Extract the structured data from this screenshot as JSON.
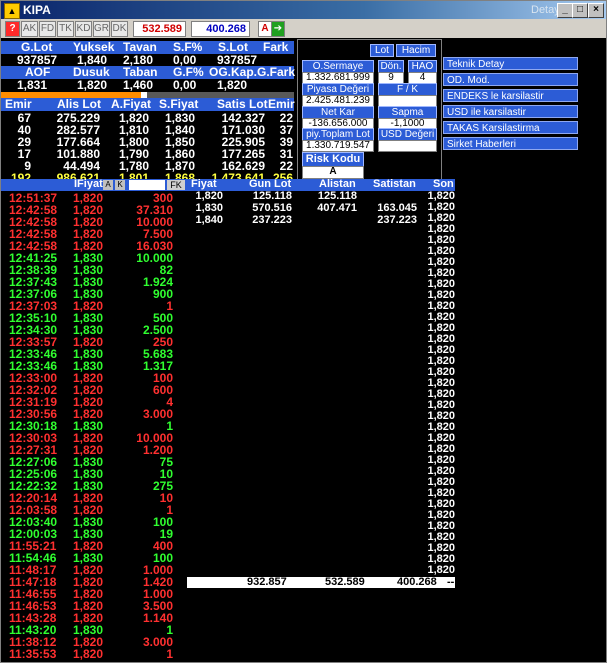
{
  "window": {
    "title": "KIPA",
    "detay": "Detay",
    "minimize": "_",
    "restore": "□",
    "close": "×"
  },
  "toolbar": {
    "tabs": [
      "AK",
      "FD",
      "TK",
      "KD",
      "GR",
      "DK"
    ],
    "val1": "532.589",
    "val2": "400.268",
    "a_label": "A"
  },
  "summary": {
    "headers": [
      "G.Lot",
      "Yuksek",
      "Tavan",
      "S.F%",
      "S.Lot",
      "Fark"
    ],
    "values": [
      "937857",
      "1,840",
      "2,180",
      "0,00",
      "937857",
      ""
    ],
    "headers2": [
      "AOF",
      "Dusuk",
      "Taban",
      "G.F%",
      "OG.Kap.",
      "G.Fark"
    ],
    "values2": [
      "1,831",
      "1,820",
      "1,460",
      "0,00",
      "1,820",
      ""
    ]
  },
  "depth": {
    "headers": [
      "Emir",
      "Alis Lot",
      "A.Fiyat",
      "S.Fiyat",
      "Satis Lot",
      "Emir"
    ],
    "rows": [
      [
        "67",
        "275.229",
        "1,820",
        "1,830",
        "142.327",
        "22"
      ],
      [
        "40",
        "282.577",
        "1,810",
        "1,840",
        "171.030",
        "37"
      ],
      [
        "29",
        "177.664",
        "1,800",
        "1,850",
        "225.905",
        "39"
      ],
      [
        "17",
        "101.880",
        "1,790",
        "1,860",
        "177.265",
        "31"
      ],
      [
        "9",
        "44.494",
        "1,780",
        "1,870",
        "162.629",
        "22"
      ]
    ],
    "total": [
      "192",
      "986.621",
      "1,801",
      "1,868",
      "1.473.641",
      "256"
    ]
  },
  "panel": {
    "lot": "Lot",
    "hacim": "Hacim",
    "osermaye": "O.Sermaye",
    "osermaye_val": "1.332.681.999",
    "don": "Dön.",
    "don_val": "9",
    "hao": "HAO",
    "hao_val": "4",
    "piyasa": "Piyasa Değeri",
    "piyasa_val": "2.425.481.239",
    "fk": "F / K",
    "fk_val": "",
    "netkar": "Net Kar",
    "netkar_val": "-136.656.000",
    "sapma": "Sapma",
    "sapma_val": "-1,1000",
    "piytoplam": "piy.Toplam Lot",
    "piytoplam_val": "1.330.719.547",
    "usd": "USD Değeri",
    "usd_val": "",
    "risk": "Risk Kodu",
    "risk_val": "A"
  },
  "rightmenu": [
    "Teknik Detay",
    "OD. Mod.",
    "ENDEKS le karsilastir",
    "USD ile karsilastir",
    "TAKAS Karsilastirma",
    "Sirket Haberleri"
  ],
  "trades": {
    "headers": [
      "",
      "IFiyat",
      "A",
      "K",
      "FK"
    ],
    "rows": [
      [
        "12:51:37",
        "1,820",
        "300",
        "r"
      ],
      [
        "12:42:58",
        "1,820",
        "37.310",
        "r"
      ],
      [
        "12:42:58",
        "1,820",
        "10.000",
        "r"
      ],
      [
        "12:42:58",
        "1,820",
        "7.500",
        "r"
      ],
      [
        "12:42:58",
        "1,820",
        "16.030",
        "r"
      ],
      [
        "12:41:25",
        "1,830",
        "10.000",
        "g"
      ],
      [
        "12:38:39",
        "1,830",
        "82",
        "g"
      ],
      [
        "12:37:43",
        "1,830",
        "1.924",
        "g"
      ],
      [
        "12:37:06",
        "1,830",
        "900",
        "g"
      ],
      [
        "12:37:03",
        "1,820",
        "1",
        "r"
      ],
      [
        "12:35:10",
        "1,830",
        "500",
        "g"
      ],
      [
        "12:34:30",
        "1,830",
        "2.500",
        "g"
      ],
      [
        "12:33:57",
        "1,820",
        "250",
        "r"
      ],
      [
        "12:33:46",
        "1,830",
        "5.683",
        "g"
      ],
      [
        "12:33:46",
        "1,830",
        "1.317",
        "g"
      ],
      [
        "12:33:00",
        "1,820",
        "100",
        "r"
      ],
      [
        "12:32:02",
        "1,820",
        "600",
        "r"
      ],
      [
        "12:31:19",
        "1,820",
        "4",
        "r"
      ],
      [
        "12:30:56",
        "1,820",
        "3.000",
        "r"
      ],
      [
        "12:30:18",
        "1,830",
        "1",
        "g"
      ],
      [
        "12:30:03",
        "1,820",
        "10.000",
        "r"
      ],
      [
        "12:27:31",
        "1,820",
        "1.200",
        "r"
      ],
      [
        "12:27:06",
        "1,830",
        "75",
        "g"
      ],
      [
        "12:25:06",
        "1,830",
        "10",
        "g"
      ],
      [
        "12:22:32",
        "1,830",
        "275",
        "g"
      ],
      [
        "12:20:14",
        "1,820",
        "10",
        "r"
      ],
      [
        "12:03:58",
        "1,820",
        "1",
        "r"
      ],
      [
        "12:03:40",
        "1,830",
        "100",
        "g"
      ],
      [
        "12:00:03",
        "1,830",
        "19",
        "g"
      ],
      [
        "11:55:21",
        "1,820",
        "400",
        "r"
      ],
      [
        "11:54:46",
        "1,830",
        "100",
        "g"
      ],
      [
        "11:48:17",
        "1,820",
        "1.000",
        "r"
      ],
      [
        "11:47:18",
        "1,820",
        "1.420",
        "r"
      ],
      [
        "11:46:55",
        "1,820",
        "1.000",
        "r"
      ],
      [
        "11:46:53",
        "1,820",
        "3.500",
        "r"
      ],
      [
        "11:43:28",
        "1,820",
        "1.140",
        "r"
      ],
      [
        "11:43:20",
        "1,830",
        "1",
        "g"
      ],
      [
        "11:38:12",
        "1,820",
        "3.000",
        "r"
      ],
      [
        "11:35:53",
        "1,820",
        "1",
        "r"
      ]
    ]
  },
  "pricelevels": {
    "headers": [
      "Fiyat",
      "Gun Lot",
      "Alistan",
      "Satistan",
      "Son"
    ],
    "rows": [
      [
        "1,820",
        "125.118",
        "125.118",
        "",
        ""
      ],
      [
        "1,830",
        "570.516",
        "407.471",
        "163.045",
        ""
      ],
      [
        "1,840",
        "237.223",
        "",
        "237.223",
        ""
      ]
    ],
    "son": "1,820",
    "son_count": 35,
    "totals": [
      "932.857",
      "532.589",
      "400.268",
      "--"
    ]
  }
}
